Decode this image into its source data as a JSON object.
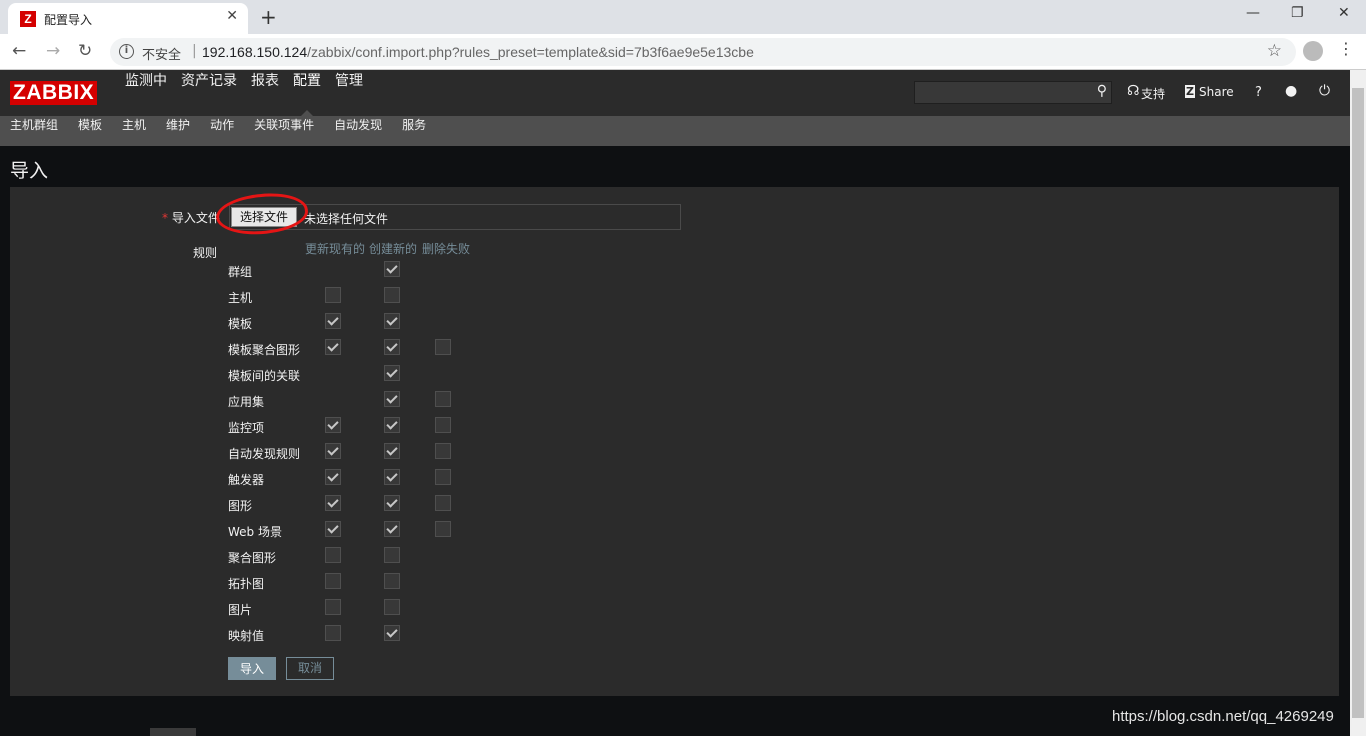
{
  "browser": {
    "tab_title": "配置导入",
    "tab_icon_letter": "Z",
    "security_label": "不安全",
    "url_host": "192.168.150.124",
    "url_path": "/zabbix/conf.import.php?rules_preset=template&sid=7b3f6ae9e5e13cbe"
  },
  "header": {
    "logo": "ZABBIX",
    "nav": [
      "监测中",
      "资产记录",
      "报表",
      "配置",
      "管理"
    ],
    "active_nav": "配置",
    "support_label": "支持",
    "share_label": "Share",
    "help_label": "?"
  },
  "subnav": [
    "主机群组",
    "模板",
    "主机",
    "维护",
    "动作",
    "关联项事件",
    "自动发现",
    "服务"
  ],
  "page": {
    "title": "导入",
    "import_file_label": "导入文件",
    "file_button_label": "选择文件",
    "file_none_text": "未选择任何文件",
    "rules_label": "规则",
    "col_update": "更新现有的",
    "col_create": "创建新的",
    "col_delete": "删除失败",
    "import_button": "导入",
    "cancel_button": "取消"
  },
  "rules": [
    {
      "name": "群组",
      "update": null,
      "create": true,
      "delete": null
    },
    {
      "name": "主机",
      "update": false,
      "create": false,
      "delete": null
    },
    {
      "name": "模板",
      "update": true,
      "create": true,
      "delete": null
    },
    {
      "name": "模板聚合图形",
      "update": true,
      "create": true,
      "delete": false
    },
    {
      "name": "模板间的关联",
      "update": null,
      "create": true,
      "delete": null
    },
    {
      "name": "应用集",
      "update": null,
      "create": true,
      "delete": false
    },
    {
      "name": "监控项",
      "update": true,
      "create": true,
      "delete": false
    },
    {
      "name": "自动发现规则",
      "update": true,
      "create": true,
      "delete": false
    },
    {
      "name": "触发器",
      "update": true,
      "create": true,
      "delete": false
    },
    {
      "name": "图形",
      "update": true,
      "create": true,
      "delete": false
    },
    {
      "name": "Web 场景",
      "update": true,
      "create": true,
      "delete": false
    },
    {
      "name": "聚合图形",
      "update": false,
      "create": false,
      "delete": null
    },
    {
      "name": "拓扑图",
      "update": false,
      "create": false,
      "delete": null
    },
    {
      "name": "图片",
      "update": false,
      "create": false,
      "delete": null
    },
    {
      "name": "映射值",
      "update": false,
      "create": true,
      "delete": null
    }
  ],
  "watermark": "https://blog.csdn.net/qq_4269249"
}
